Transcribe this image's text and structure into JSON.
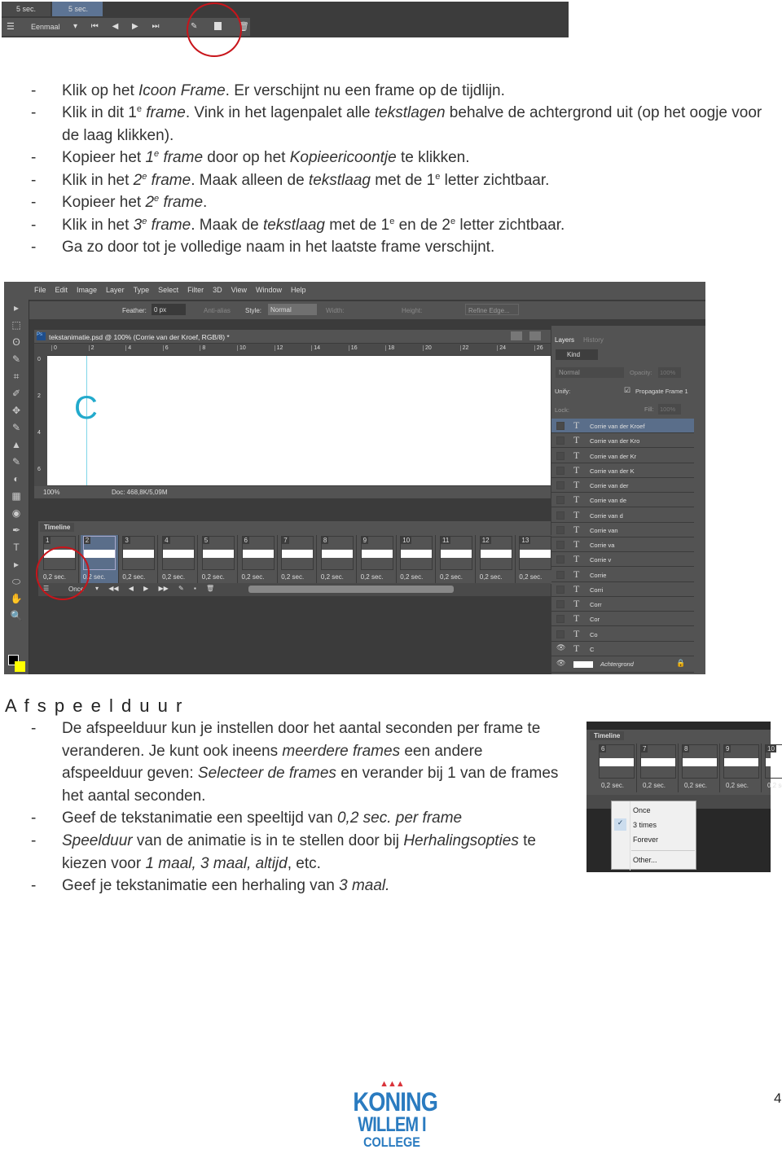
{
  "top_strip": {
    "durations": [
      "5 sec.",
      "5 sec."
    ],
    "loop": "Eenmaal"
  },
  "instructions": [
    [
      {
        "t": "Klik op het "
      },
      {
        "t": "Icoon Frame",
        "i": 1
      },
      {
        "t": ". Er verschijnt nu een frame op de tijdlijn."
      }
    ],
    [
      {
        "t": "Klik in dit 1"
      },
      {
        "t": "e",
        "s": 1
      },
      {
        "t": " frame",
        "i": 1
      },
      {
        "t": ". Vink in het lagenpalet alle "
      },
      {
        "t": "tekstlagen",
        "i": 1
      },
      {
        "t": " behalve de achtergrond uit (op het oogje voor de laag klikken)."
      }
    ],
    [
      {
        "t": "Kopieer het "
      },
      {
        "t": "1",
        "i": 1
      },
      {
        "t": "e",
        "s": 1,
        "i": 1
      },
      {
        "t": " frame",
        "i": 1
      },
      {
        "t": " door op het "
      },
      {
        "t": "Kopieericoontje",
        "i": 1
      },
      {
        "t": " te klikken."
      }
    ],
    [
      {
        "t": "Klik in het "
      },
      {
        "t": "2",
        "i": 1
      },
      {
        "t": "e",
        "s": 1,
        "i": 1
      },
      {
        "t": " frame",
        "i": 1
      },
      {
        "t": ". Maak alleen de "
      },
      {
        "t": "tekstlaag",
        "i": 1
      },
      {
        "t": " met de 1"
      },
      {
        "t": "e",
        "s": 1
      },
      {
        "t": " letter zichtbaar."
      }
    ],
    [
      {
        "t": "Kopieer het "
      },
      {
        "t": "2",
        "i": 1
      },
      {
        "t": "e",
        "s": 1,
        "i": 1
      },
      {
        "t": " frame",
        "i": 1
      },
      {
        "t": "."
      }
    ],
    [
      {
        "t": "Klik in het "
      },
      {
        "t": "3",
        "i": 1
      },
      {
        "t": "e",
        "s": 1,
        "i": 1
      },
      {
        "t": " frame",
        "i": 1
      },
      {
        "t": ". Maak de "
      },
      {
        "t": "tekstlaag",
        "i": 1
      },
      {
        "t": " met de 1"
      },
      {
        "t": "e",
        "s": 1
      },
      {
        "t": " en de 2"
      },
      {
        "t": "e",
        "s": 1
      },
      {
        "t": " letter zichtbaar."
      }
    ],
    [
      {
        "t": "Ga zo door tot je volledige naam in het laatste frame verschijnt."
      }
    ]
  ],
  "photoshop": {
    "menu": [
      "File",
      "Edit",
      "Image",
      "Layer",
      "Type",
      "Select",
      "Filter",
      "3D",
      "View",
      "Window",
      "Help"
    ],
    "options": {
      "feather_label": "Feather:",
      "feather": "0 px",
      "antialias": "Anti-alias",
      "style_label": "Style:",
      "style": "Normal",
      "width_label": "Width:",
      "height_label": "Height:",
      "refine": "Refine Edge..."
    },
    "doc_title": "tekstanimatie.psd @ 100% (Corrie van der Kroef, RGB/8) *",
    "ruler": [
      "0",
      "2",
      "4",
      "6",
      "8",
      "10",
      "12",
      "14",
      "16",
      "18",
      "20",
      "22",
      "24",
      "26"
    ],
    "ruler_v": [
      "0",
      "2",
      "4",
      "6"
    ],
    "canvas_letter": "C",
    "zoom": "100%",
    "doc_info": "Doc: 468,8K/5,09M",
    "timeline": {
      "title": "Timeline",
      "frames": [
        "1",
        "2",
        "3",
        "4",
        "5",
        "6",
        "7",
        "8",
        "9",
        "10",
        "11",
        "12",
        "13"
      ],
      "duration": "0,2 sec.",
      "selected_frame": "2",
      "loop": "Once"
    },
    "layers": {
      "tabs": [
        "Layers",
        "History"
      ],
      "kind": "Kind",
      "blend": "Normal",
      "opacity_label": "Opacity:",
      "opacity": "100%",
      "unify": "Unify:",
      "propagate": "Propagate Frame 1",
      "lock": "Lock:",
      "fill_label": "Fill:",
      "fill": "100%",
      "items": [
        "Corrie van der Kroef",
        "Corrie van der Kro",
        "Corrie van der Kr",
        "Corrie van der K",
        "Corrie van der",
        "Corrie van de",
        "Corrie van d",
        "Corrie van",
        "Corrie va",
        "Corrie v",
        "Corrie",
        "Corri",
        "Corr",
        "Cor",
        "Co",
        "C"
      ],
      "visible": [
        "C"
      ],
      "background": "Achtergrond"
    }
  },
  "section_title": "A f s p e e l d u u r",
  "playback": [
    [
      {
        "t": "De afspeelduur kun je instellen door het aantal seconden per frame te veranderen. Je kunt ook ineens "
      },
      {
        "t": "meerdere frames",
        "i": 1
      },
      {
        "t": " een andere afspeelduur geven: "
      },
      {
        "t": "Selecteer de frames",
        "i": 1
      },
      {
        "t": " en verander bij 1 van de frames het aantal seconden."
      }
    ],
    [
      {
        "t": "Geef de tekstanimatie een speeltijd van "
      },
      {
        "t": "0,2 sec.  per frame",
        "i": 1
      }
    ],
    [
      {
        "t": "Speelduur",
        "i": 1
      },
      {
        "t": " van de animatie is in te stellen door bij "
      },
      {
        "t": "Herhalingsopties",
        "i": 1
      },
      {
        "t": " te kiezen voor "
      },
      {
        "t": "1 maal, 3 maal, altijd",
        "i": 1
      },
      {
        "t": ", etc."
      }
    ],
    [
      {
        "t": "Geef je tekstanimatie een herhaling van "
      },
      {
        "t": "3 maal.",
        "i": 1
      }
    ]
  ],
  "small_shot": {
    "title": "Timeline",
    "frames": [
      "6",
      "7",
      "8",
      "9",
      "10"
    ],
    "duration": "0,2 sec.",
    "menu": [
      "Once",
      "3 times",
      "Forever",
      "Other..."
    ],
    "checked": "3 times"
  },
  "logo": {
    "text": [
      "KONING",
      "WILLEM I",
      "COLLEGE"
    ],
    "color": "#2a7bc0",
    "crown": "#d9333a"
  },
  "page_number": "4",
  "colors": {
    "highlight_circle": "#c8151b",
    "ps_bg": "#535353",
    "selected_layer": "#5a6e8a"
  }
}
